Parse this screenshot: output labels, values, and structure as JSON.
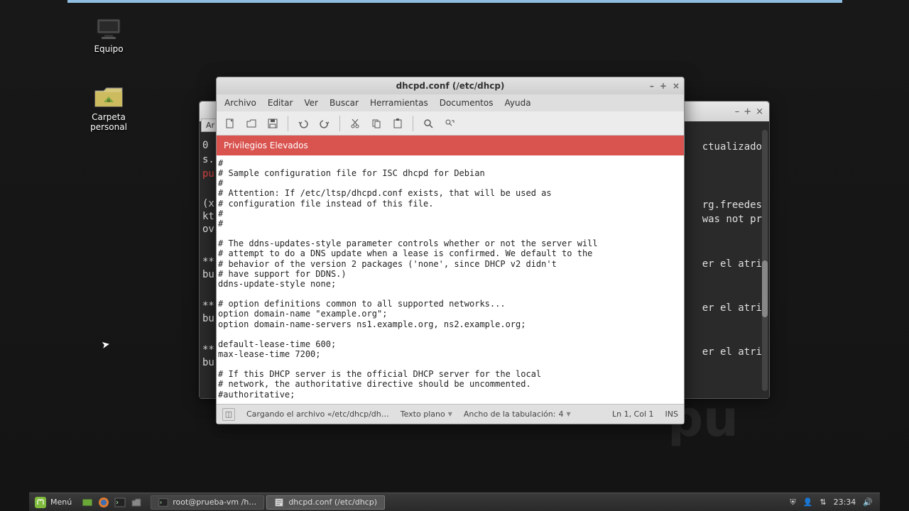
{
  "desktop": {
    "icons": [
      {
        "name": "computer-icon",
        "label": "Equipo"
      },
      {
        "name": "home-folder-icon",
        "label": "Carpeta personal"
      }
    ]
  },
  "terminal": {
    "buttons": {
      "min": "–",
      "max": "+",
      "close": "×"
    },
    "fragments": {
      "l1": "ctualizado",
      "l2": "rg.freedes",
      "l3": "was not pr",
      "l4": "er el atri",
      "l5": "er el atri",
      "l6": "er el atri",
      "left1": "0",
      "left2": "s.",
      "left3": "pu",
      "left4": "(x",
      "left5": "kt",
      "left6": "ov",
      "left7": "**",
      "left8": "bu",
      "left9": "**",
      "left10": "bu",
      "left11": "**",
      "left12": "bu"
    }
  },
  "editor": {
    "title": "dhcpd.conf (/etc/dhcp)",
    "window_controls": {
      "min": "–",
      "max": "+",
      "close": "×"
    },
    "menus": [
      "Archivo",
      "Editar",
      "Ver",
      "Buscar",
      "Herramientas",
      "Documentos",
      "Ayuda"
    ],
    "toolbar_icons": [
      "new-file-icon",
      "open-file-icon",
      "save-file-icon",
      "undo-icon",
      "redo-icon",
      "cut-icon",
      "copy-icon",
      "paste-icon",
      "search-icon",
      "search-replace-icon"
    ],
    "banner": "Privilegios Elevados",
    "content": "#\n# Sample configuration file for ISC dhcpd for Debian\n#\n# Attention: If /etc/ltsp/dhcpd.conf exists, that will be used as\n# configuration file instead of this file.\n#\n#\n\n# The ddns-updates-style parameter controls whether or not the server will\n# attempt to do a DNS update when a lease is confirmed. We default to the\n# behavior of the version 2 packages ('none', since DHCP v2 didn't\n# have support for DDNS.)\nddns-update-style none;\n\n# option definitions common to all supported networks...\noption domain-name \"example.org\";\noption domain-name-servers ns1.example.org, ns2.example.org;\n\ndefault-lease-time 600;\nmax-lease-time 7200;\n\n# If this DHCP server is the official DHCP server for the local\n# network, the authoritative directive should be uncommented.\n#authoritative;",
    "status": {
      "panel_btn": "◫",
      "message": "Cargando el archivo «/etc/dhcp/dh…",
      "syntax": "Texto plano",
      "tab_width_label": "Ancho de la tabulación:",
      "tab_width_value": "4",
      "cursor_pos": "Ln 1, Col 1",
      "ins_mode": "INS"
    }
  },
  "editor_tab_behind": "Ar",
  "panel": {
    "menu_label": "Menú",
    "quicklaunch": [
      "show-desktop-icon",
      "firefox-icon",
      "terminal-icon",
      "files-icon"
    ],
    "tasks": [
      {
        "icon": "terminal-icon",
        "label": "root@prueba-vm /h…",
        "active": false
      },
      {
        "icon": "gedit-icon",
        "label": "dhcpd.conf (/etc/dhcp)",
        "active": true
      }
    ],
    "tray": {
      "shield": "⛨",
      "user": "👤",
      "network": "⇅",
      "clock": "23:34",
      "sound": "🔊"
    }
  }
}
